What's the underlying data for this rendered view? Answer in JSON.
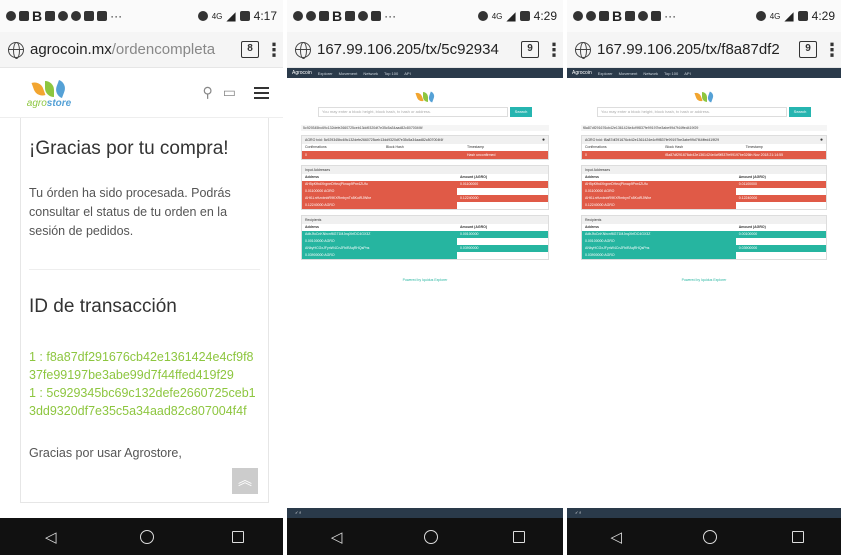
{
  "phones": [
    {
      "status": {
        "sim": "4G",
        "time": "4:17"
      },
      "url": {
        "main": "agrocoin.mx",
        "path": "/ordencompleta",
        "tabs": "8"
      },
      "logo_word": "agro",
      "logo_word2": "store",
      "thanks": "¡Gracias por tu compra!",
      "message": "Tu órden ha sido procesada. Podrás consultar el status de tu orden en la sesión de pedidos.",
      "tx_title": "ID de transacción",
      "tx1": "1 : f8a87df291676cb42e1361424e4cf9f837fe99197be3abe99d7f44ffed419f29",
      "tx2": "1 : 5c929345bc69c132defe2660725ceb13dd9320df7e35c5a34aad82c807004f4f",
      "bye": "Gracias por usar Agrostore,"
    },
    {
      "status": {
        "sim": "4G",
        "time": "4:29"
      },
      "url": {
        "main": "167.99.106.205",
        "path": "/tx/5c92934",
        "tabs": "9"
      },
      "hash": "5c929345bc69c132defe2660725ceb13dd9320df7e35c5a34aad82c807004f4f",
      "powered": "Powered by Iquidus Explorer"
    },
    {
      "status": {
        "sim": "4G",
        "time": "4:29"
      },
      "url": {
        "main": "167.99.106.205",
        "path": "/tx/f8a87df2",
        "tabs": "9"
      },
      "hash": "f8a87df291676cb42e1361424e4cf9f837fe99197be3abe99d7f44ffed419f29",
      "timestamp": "26th Nov 2018 21:14:55",
      "powered": "Powered by Iquidus Explorer"
    }
  ],
  "explorer": {
    "brand": "Agrocoin",
    "nav": [
      "Explorer",
      "Movement",
      "Network",
      "Top 100",
      "API"
    ],
    "search_placeholder": "You may enter a block height, block hash, tx hash or address.",
    "search_btn": "Search",
    "panel_prefix": "AGRO txid:",
    "col_confirm": "Confirmations",
    "col_block": "Block Hash",
    "col_time": "Timestamp",
    "confirm_val": "0",
    "block_val": "Hash unconfirmed",
    "input_title": "Input Addresses",
    "recipients_title": "Recipients",
    "addr_col": "Address",
    "amount_col": "Amount (AGRO)",
    "in_addr1": "AH5pKfhdXhgneDHeojPknap9Pnr4ZUfu",
    "in_amt1": "0.01100000 AGRO",
    "in_addr2": "AHt1LnHzxbnbR9KXRmbynTx8KoiRJWhe",
    "in_amt2": "0.12240000 AGRO",
    "in_side1": "0.01100000",
    "in_side2": "0.12240000",
    "out_addr1": "AdbJfoCnKNhcnf6G71MJnqXhfDC4GX3Z",
    "out_amt1": "0.00100000 AGRO",
    "out_addr2": "ANbyHCGxJFynW4CnJFbiRAqRHQsPns",
    "out_amt2": "0.03900000 AGRO",
    "out_side1": "0.00100000",
    "out_side2": "0.03900000"
  },
  "colors": {
    "green": "#8dc63f",
    "teal": "#26b5a0",
    "red": "#e05a47",
    "navy": "#2a3a4a"
  }
}
